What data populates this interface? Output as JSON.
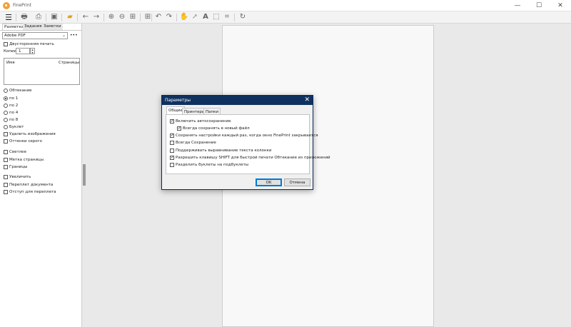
{
  "window": {
    "title": "FinePrint",
    "minimize_glyph": "—",
    "maximize_glyph": "☐",
    "close_glyph": "✕"
  },
  "toolbar": {
    "icons": [
      "menu-icon",
      "printer-icon",
      "print-preview-icon",
      "save-icon",
      "open-folder-icon",
      "arrow-left-icon",
      "arrow-right-icon",
      "zoom-in-icon",
      "zoom-out-icon",
      "fit-page-icon",
      "undo-icon",
      "redo-icon",
      "hand-icon",
      "pointer-icon",
      "text-icon",
      "select-rect-icon",
      "crop-icon",
      "refresh-icon"
    ],
    "glyphs": {
      "menu": "☰",
      "printer": "🖶",
      "preview": "⎙",
      "save": "▣",
      "folder": "▰",
      "back": "←",
      "forward": "→",
      "zoom_in": "⊕",
      "zoom_out": "⊖",
      "fit": "⊞",
      "undo": "↶",
      "redo": "↷",
      "hand": "✋",
      "pointer": "➚",
      "text": "A",
      "select": "⬚",
      "crop": "⌗",
      "refresh": "↻"
    }
  },
  "left_panel": {
    "tabs": [
      "Разметка",
      "Задания",
      "Заметки"
    ],
    "printer": "Adobe PDF",
    "more_label": "•••",
    "duplex_label": "Двусторонняя печать",
    "copies_label": "Копии:",
    "copies_value": "1",
    "jobs_columns": [
      "Имя",
      "Страницы"
    ],
    "layout_options": [
      {
        "label": "Обтекание",
        "checked": false
      },
      {
        "label": "по 1",
        "checked": true
      },
      {
        "label": "по 2",
        "checked": false
      },
      {
        "label": "по 4",
        "checked": false
      },
      {
        "label": "по 8",
        "checked": false
      },
      {
        "label": "Буклет",
        "checked": false
      }
    ],
    "remove_images": "Удалить изображения",
    "grayscale": "Оттенки серого",
    "lighter": "Светлее",
    "page_label": "Метка страницы",
    "borders": "Границы",
    "enlarge": "Увеличить",
    "binding": "Переплет документа",
    "gutter": "Отступ для переплета"
  },
  "dialog": {
    "title": "Параметры",
    "close_glyph": "✕",
    "tabs": [
      "Общие",
      "Принтеры",
      "Папки"
    ],
    "options": [
      {
        "label": "Включить автосохранение",
        "checked": true,
        "indent": false
      },
      {
        "label": "Всегда сохранять в новый файл",
        "checked": true,
        "indent": true
      },
      {
        "label": "Сохранять настройки каждый раз, когда окно FinePrint закрывается",
        "checked": true,
        "indent": false
      },
      {
        "label": "Всегда Сохранение",
        "checked": false,
        "indent": false
      },
      {
        "label": "Поддерживать выравнивание текста колонки",
        "checked": false,
        "indent": false
      },
      {
        "label": "Разрешить клавишу SHIFT для быстрой печати Обтекание из приложений",
        "checked": true,
        "indent": false
      },
      {
        "label": "Разделить буклеты на подбуклеты",
        "checked": false,
        "indent": false
      }
    ],
    "ok_label": "OK",
    "cancel_label": "Отмена"
  }
}
